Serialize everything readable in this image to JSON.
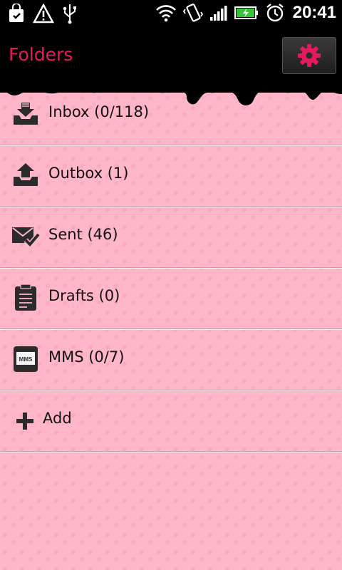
{
  "status_bar": {
    "time": "20:41",
    "left_icons": [
      "shopping-bag-icon",
      "warning-icon",
      "usb-icon"
    ],
    "right_icons": [
      "wifi-icon",
      "vibrate-icon",
      "signal-icon",
      "battery-icon",
      "alarm-icon"
    ]
  },
  "header": {
    "title": "Folders",
    "settings_icon": "gear-icon",
    "accent_color": "#e5195e"
  },
  "folders": [
    {
      "label": "Inbox (0/118)",
      "icon": "inbox-icon"
    },
    {
      "label": "Outbox (1)",
      "icon": "outbox-icon"
    },
    {
      "label": "Sent (46)",
      "icon": "sent-icon"
    },
    {
      "label": "Drafts (0)",
      "icon": "drafts-icon"
    },
    {
      "label": "MMS (0/7)",
      "icon": "mms-icon"
    },
    {
      "label": "Add",
      "icon": "plus-icon"
    }
  ],
  "mms_badge": "MMS"
}
